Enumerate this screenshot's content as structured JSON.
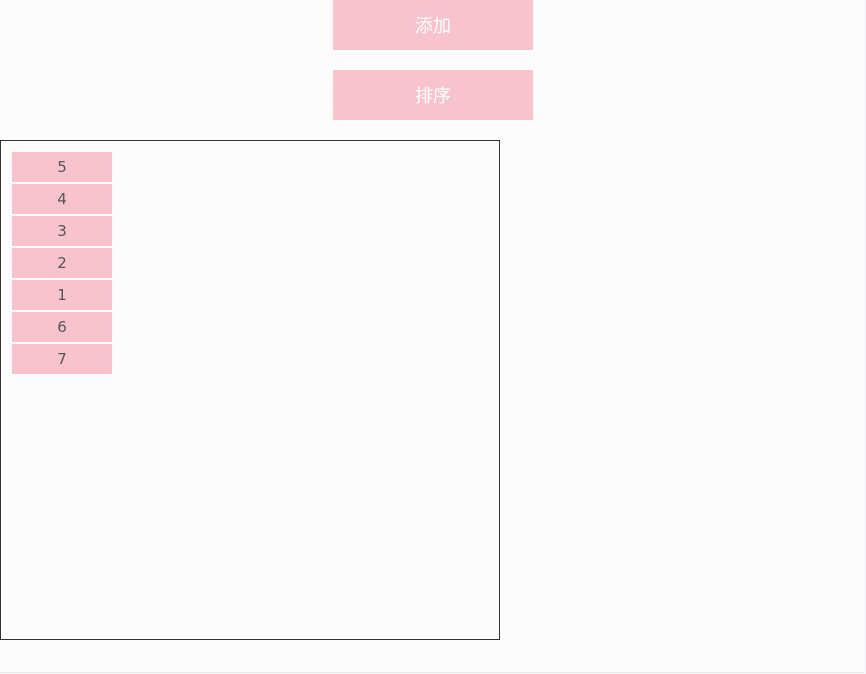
{
  "buttons": {
    "add_label": "添加",
    "sort_label": "排序"
  },
  "list": {
    "items": [
      "5",
      "4",
      "3",
      "2",
      "1",
      "6",
      "7"
    ]
  },
  "colors": {
    "button_bg": "#f9c3cd",
    "item_bg": "#f9c3cd",
    "border": "#333333",
    "page_bg": "#fcfcfd"
  }
}
